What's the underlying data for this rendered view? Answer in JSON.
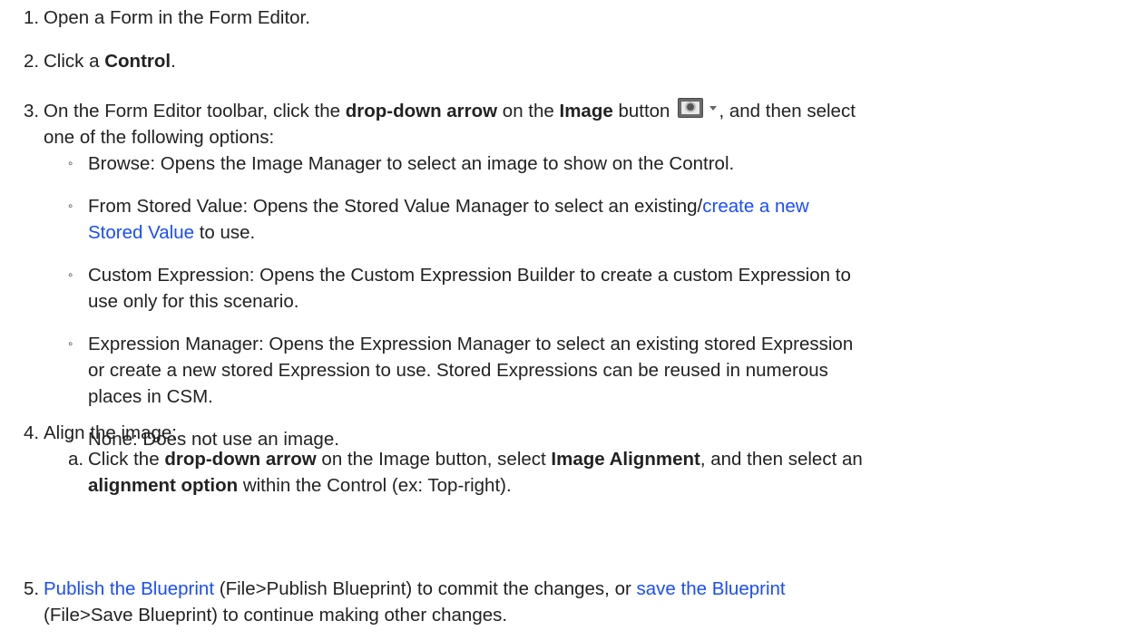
{
  "steps": {
    "s1": {
      "num": "1.",
      "text": "Open a Form in the Form Editor."
    },
    "s2": {
      "num": "2.",
      "text_before": "Click a ",
      "bold": "Control",
      "text_after": "."
    },
    "s3": {
      "num": "3.",
      "t1": "On the Form Editor toolbar, click the ",
      "b1": "drop-down arrow",
      "t2": " on the ",
      "b2": "Image",
      "t3": " button",
      "t4": ", and then select",
      "t5": "one of the following options:",
      "options": {
        "browse": "Browse: Opens the Image Manager to select an image to show on the Control.",
        "stored_before": "From Stored Value: Opens the Stored Value Manager to select an existing/",
        "stored_link_1": "create a new",
        "stored_link_2": "Stored Value",
        "stored_after": " to use.",
        "custom_1": "Custom Expression: Opens the Custom Expression Builder to create a custom Expression to",
        "custom_2": "use only for this scenario.",
        "manager_1": "Expression Manager: Opens the Expression Manager to select an existing stored Expression",
        "manager_2": "or create a new stored Expression to use. Stored Expressions can be reused in numerous",
        "manager_3": "places in CSM.",
        "none": "None: Does not use an image."
      },
      "icons": {
        "image_button": "camera-icon",
        "dropdown": "chevron-down-icon"
      }
    },
    "s4": {
      "num": "4.",
      "text": "Align the image:",
      "a": {
        "letter": "a.",
        "t1": "Click the ",
        "b1": "drop-down arrow",
        "t2": " on the Image button, select ",
        "b2": "Image Alignment",
        "t3": ", and then select an",
        "b3": "alignment option",
        "t4": " within the Control (ex: Top-right)."
      }
    },
    "s5": {
      "num": "5.",
      "link1": "Publish the Blueprint",
      "t1": " (File>Publish Blueprint) to commit the changes, or ",
      "link2": "save the Blueprint",
      "t2": "(File>Save Blueprint) to continue making other changes."
    }
  },
  "colors": {
    "text": "#222222",
    "link": "#1a4dff"
  }
}
